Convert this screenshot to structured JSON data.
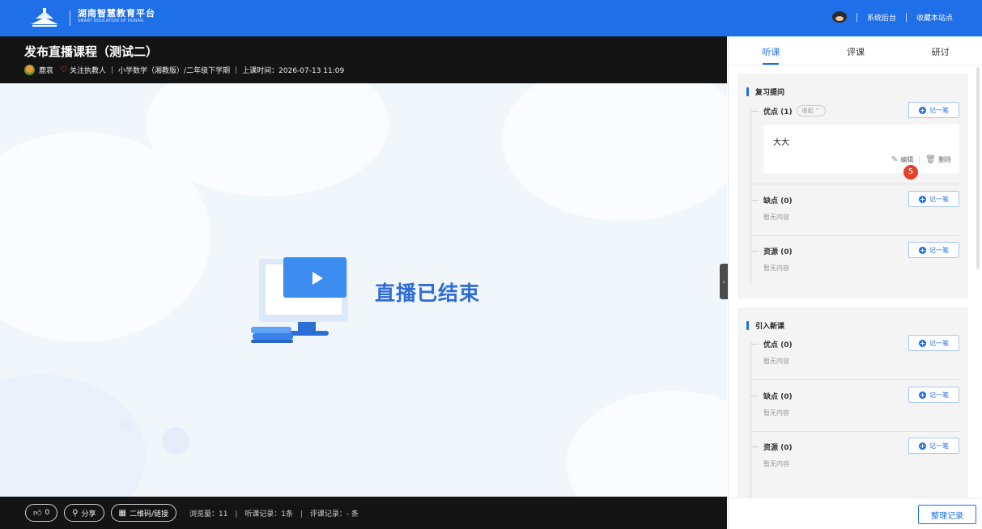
{
  "header": {
    "brand_cn": "湖南智慧教育平台",
    "brand_en": "SMART EDUCATION OF HUNAN",
    "admin_link": "系统后台",
    "bookmark_link": "收藏本站点",
    "color": "#1f6fe8"
  },
  "course": {
    "title": "发布直播课程（测试二）",
    "teacher": "鹿哀",
    "follow": "关注执教人",
    "subject": "小学数学（湘教版）/二年级下学期",
    "time_label": "上课时间：2026-07-13 11:09",
    "separator": "|"
  },
  "video": {
    "status_text": "直播已结束"
  },
  "footer": {
    "like_count": "0",
    "share": "分享",
    "qrcode": "二维码/链接",
    "views": "浏览量：11",
    "listen_records": "听课记录：1条",
    "review_records": "评课记录：- 条"
  },
  "panel": {
    "tabs": [
      "听课",
      "评课",
      "研讨"
    ],
    "note_btn": "记一笔",
    "empty_text": "暂无内容",
    "cards": [
      {
        "title": "复习提问",
        "sections": [
          {
            "name": "优点 (1)",
            "collapse": "收起"
          },
          {
            "name": "缺点 (0)"
          },
          {
            "name": "资源 (0)"
          }
        ],
        "note": {
          "text": "大大",
          "edit": "编辑",
          "delete": "删除",
          "badge": "5"
        }
      },
      {
        "title": "引入新课",
        "sections": [
          {
            "name": "优点 (0)"
          },
          {
            "name": "缺点 (0)"
          },
          {
            "name": "资源 (0)"
          }
        ]
      }
    ],
    "organize_btn": "整理记录"
  }
}
